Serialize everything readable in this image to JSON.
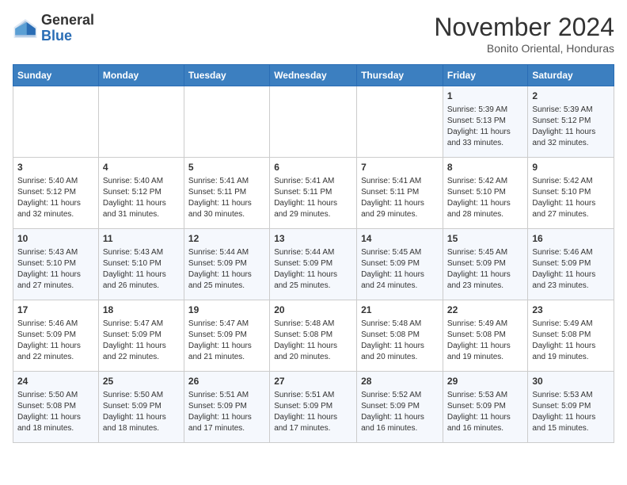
{
  "logo": {
    "line1": "General",
    "line2": "Blue"
  },
  "title": "November 2024",
  "subtitle": "Bonito Oriental, Honduras",
  "headers": [
    "Sunday",
    "Monday",
    "Tuesday",
    "Wednesday",
    "Thursday",
    "Friday",
    "Saturday"
  ],
  "weeks": [
    [
      {
        "day": "",
        "info": ""
      },
      {
        "day": "",
        "info": ""
      },
      {
        "day": "",
        "info": ""
      },
      {
        "day": "",
        "info": ""
      },
      {
        "day": "",
        "info": ""
      },
      {
        "day": "1",
        "info": "Sunrise: 5:39 AM\nSunset: 5:13 PM\nDaylight: 11 hours and 33 minutes."
      },
      {
        "day": "2",
        "info": "Sunrise: 5:39 AM\nSunset: 5:12 PM\nDaylight: 11 hours and 32 minutes."
      }
    ],
    [
      {
        "day": "3",
        "info": "Sunrise: 5:40 AM\nSunset: 5:12 PM\nDaylight: 11 hours and 32 minutes."
      },
      {
        "day": "4",
        "info": "Sunrise: 5:40 AM\nSunset: 5:12 PM\nDaylight: 11 hours and 31 minutes."
      },
      {
        "day": "5",
        "info": "Sunrise: 5:41 AM\nSunset: 5:11 PM\nDaylight: 11 hours and 30 minutes."
      },
      {
        "day": "6",
        "info": "Sunrise: 5:41 AM\nSunset: 5:11 PM\nDaylight: 11 hours and 29 minutes."
      },
      {
        "day": "7",
        "info": "Sunrise: 5:41 AM\nSunset: 5:11 PM\nDaylight: 11 hours and 29 minutes."
      },
      {
        "day": "8",
        "info": "Sunrise: 5:42 AM\nSunset: 5:10 PM\nDaylight: 11 hours and 28 minutes."
      },
      {
        "day": "9",
        "info": "Sunrise: 5:42 AM\nSunset: 5:10 PM\nDaylight: 11 hours and 27 minutes."
      }
    ],
    [
      {
        "day": "10",
        "info": "Sunrise: 5:43 AM\nSunset: 5:10 PM\nDaylight: 11 hours and 27 minutes."
      },
      {
        "day": "11",
        "info": "Sunrise: 5:43 AM\nSunset: 5:10 PM\nDaylight: 11 hours and 26 minutes."
      },
      {
        "day": "12",
        "info": "Sunrise: 5:44 AM\nSunset: 5:09 PM\nDaylight: 11 hours and 25 minutes."
      },
      {
        "day": "13",
        "info": "Sunrise: 5:44 AM\nSunset: 5:09 PM\nDaylight: 11 hours and 25 minutes."
      },
      {
        "day": "14",
        "info": "Sunrise: 5:45 AM\nSunset: 5:09 PM\nDaylight: 11 hours and 24 minutes."
      },
      {
        "day": "15",
        "info": "Sunrise: 5:45 AM\nSunset: 5:09 PM\nDaylight: 11 hours and 23 minutes."
      },
      {
        "day": "16",
        "info": "Sunrise: 5:46 AM\nSunset: 5:09 PM\nDaylight: 11 hours and 23 minutes."
      }
    ],
    [
      {
        "day": "17",
        "info": "Sunrise: 5:46 AM\nSunset: 5:09 PM\nDaylight: 11 hours and 22 minutes."
      },
      {
        "day": "18",
        "info": "Sunrise: 5:47 AM\nSunset: 5:09 PM\nDaylight: 11 hours and 22 minutes."
      },
      {
        "day": "19",
        "info": "Sunrise: 5:47 AM\nSunset: 5:09 PM\nDaylight: 11 hours and 21 minutes."
      },
      {
        "day": "20",
        "info": "Sunrise: 5:48 AM\nSunset: 5:08 PM\nDaylight: 11 hours and 20 minutes."
      },
      {
        "day": "21",
        "info": "Sunrise: 5:48 AM\nSunset: 5:08 PM\nDaylight: 11 hours and 20 minutes."
      },
      {
        "day": "22",
        "info": "Sunrise: 5:49 AM\nSunset: 5:08 PM\nDaylight: 11 hours and 19 minutes."
      },
      {
        "day": "23",
        "info": "Sunrise: 5:49 AM\nSunset: 5:08 PM\nDaylight: 11 hours and 19 minutes."
      }
    ],
    [
      {
        "day": "24",
        "info": "Sunrise: 5:50 AM\nSunset: 5:08 PM\nDaylight: 11 hours and 18 minutes."
      },
      {
        "day": "25",
        "info": "Sunrise: 5:50 AM\nSunset: 5:09 PM\nDaylight: 11 hours and 18 minutes."
      },
      {
        "day": "26",
        "info": "Sunrise: 5:51 AM\nSunset: 5:09 PM\nDaylight: 11 hours and 17 minutes."
      },
      {
        "day": "27",
        "info": "Sunrise: 5:51 AM\nSunset: 5:09 PM\nDaylight: 11 hours and 17 minutes."
      },
      {
        "day": "28",
        "info": "Sunrise: 5:52 AM\nSunset: 5:09 PM\nDaylight: 11 hours and 16 minutes."
      },
      {
        "day": "29",
        "info": "Sunrise: 5:53 AM\nSunset: 5:09 PM\nDaylight: 11 hours and 16 minutes."
      },
      {
        "day": "30",
        "info": "Sunrise: 5:53 AM\nSunset: 5:09 PM\nDaylight: 11 hours and 15 minutes."
      }
    ]
  ]
}
